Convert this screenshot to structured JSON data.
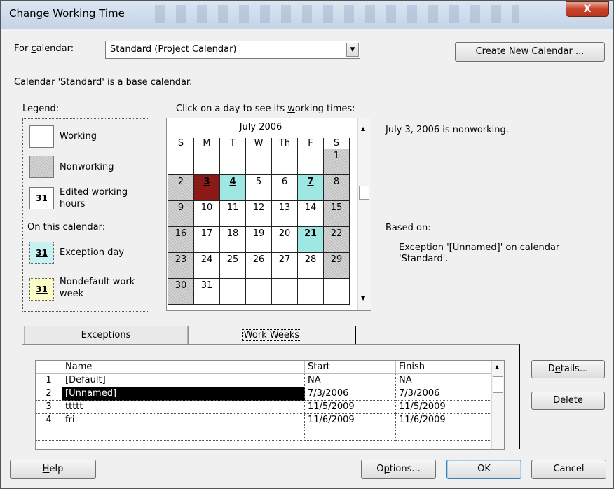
{
  "window": {
    "title": "Change Working Time",
    "close_label": "X"
  },
  "for_calendar": {
    "label_prefix": "For ",
    "label_accel": "c",
    "label_suffix": "alendar:",
    "value": "Standard (Project Calendar)"
  },
  "create_button": {
    "prefix": "Create ",
    "accel": "N",
    "suffix": "ew Calendar ..."
  },
  "base_note": "Calendar 'Standard' is a base calendar.",
  "legend": {
    "title": "Legend:",
    "working": "Working",
    "nonworking": "Nonworking",
    "edited_line1": "Edited working",
    "edited_line2": "hours",
    "on_this_calendar": "On this calendar:",
    "exception": "Exception day",
    "nondefault_line1": "Nondefault work",
    "nondefault_line2": "week",
    "swatch_number": "31"
  },
  "calendar_prompt": {
    "prefix": "Click on a day to see its ",
    "accel": "w",
    "suffix": "orking times:"
  },
  "calendar": {
    "month": "July 2006",
    "weekdays": [
      "S",
      "M",
      "T",
      "W",
      "Th",
      "F",
      "S"
    ],
    "days": [
      "",
      "",
      "",
      "",
      "",
      "",
      "1",
      "2",
      "3",
      "4",
      "5",
      "6",
      "7",
      "8",
      "9",
      "10",
      "11",
      "12",
      "13",
      "14",
      "15",
      "16",
      "17",
      "18",
      "19",
      "20",
      "21",
      "22",
      "23",
      "24",
      "25",
      "26",
      "27",
      "28",
      "29",
      "30",
      "31",
      "",
      "",
      "",
      "",
      ""
    ],
    "selected_day": "3",
    "exception_days": [
      "4",
      "7",
      "21"
    ]
  },
  "info": {
    "status": "July 3, 2006 is nonworking.",
    "based_on_label": "Based on:",
    "based_on_line1": "Exception '[Unnamed]' on calendar",
    "based_on_line2": "'Standard'."
  },
  "tabs": {
    "exceptions": "Exceptions",
    "work_weeks": "Work Weeks"
  },
  "table": {
    "headers": {
      "name": "Name",
      "start": "Start",
      "finish": "Finish"
    },
    "rows": [
      {
        "num": "1",
        "name": "[Default]",
        "start": "NA",
        "finish": "NA"
      },
      {
        "num": "2",
        "name": "[Unnamed]",
        "start": "7/3/2006",
        "finish": "7/3/2006"
      },
      {
        "num": "3",
        "name": "ttttt",
        "start": "11/5/2009",
        "finish": "11/5/2009"
      },
      {
        "num": "4",
        "name": "fri",
        "start": "11/6/2009",
        "finish": "11/6/2009"
      }
    ]
  },
  "buttons": {
    "details": {
      "accel": "e",
      "prefix": "D",
      "suffix": "tails..."
    },
    "delete": {
      "accel": "D",
      "suffix": "elete"
    },
    "help": {
      "accel": "H",
      "suffix": "elp"
    },
    "options": {
      "prefix": "O",
      "accel": "p",
      "suffix": "tions..."
    },
    "ok": "OK",
    "cancel": "Cancel"
  },
  "colors": {
    "exception": "#9ee7e3",
    "selected": "#8b1a16",
    "nondefault": "#fcfcc8"
  }
}
